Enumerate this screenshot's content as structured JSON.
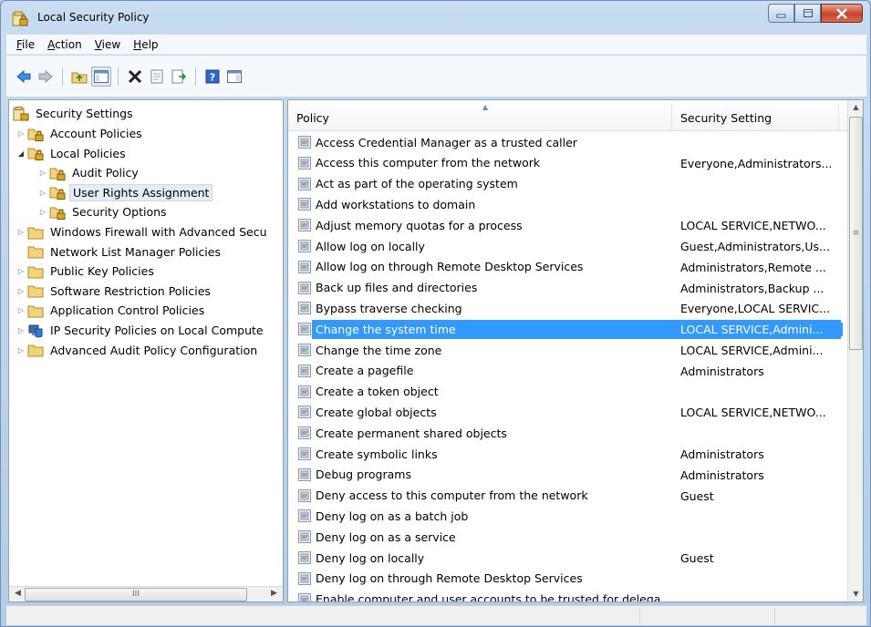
{
  "window": {
    "title": "Local Security Policy"
  },
  "menu": [
    {
      "pre": "",
      "key": "F",
      "post": "ile"
    },
    {
      "pre": "",
      "key": "A",
      "post": "ction"
    },
    {
      "pre": "",
      "key": "V",
      "post": "iew"
    },
    {
      "pre": "",
      "key": "H",
      "post": "elp"
    }
  ],
  "tree": {
    "root": "Security Settings",
    "items": [
      {
        "label": "Account Policies",
        "level": 1,
        "expander": "collapsed",
        "icon": "folder-lock-icon"
      },
      {
        "label": "Local Policies",
        "level": 1,
        "expander": "expanded",
        "icon": "folder-lock-icon"
      },
      {
        "label": "Audit Policy",
        "level": 2,
        "expander": "collapsed",
        "icon": "folder-lock-icon"
      },
      {
        "label": "User Rights Assignment",
        "level": 2,
        "expander": "collapsed",
        "icon": "folder-lock-icon",
        "selected": true
      },
      {
        "label": "Security Options",
        "level": 2,
        "expander": "collapsed",
        "icon": "folder-lock-icon"
      },
      {
        "label": "Windows Firewall with Advanced Secu",
        "level": 1,
        "expander": "collapsed",
        "icon": "folder-icon"
      },
      {
        "label": "Network List Manager Policies",
        "level": 1,
        "expander": "none",
        "icon": "folder-icon"
      },
      {
        "label": "Public Key Policies",
        "level": 1,
        "expander": "collapsed",
        "icon": "folder-icon"
      },
      {
        "label": "Software Restriction Policies",
        "level": 1,
        "expander": "collapsed",
        "icon": "folder-icon"
      },
      {
        "label": "Application Control Policies",
        "level": 1,
        "expander": "collapsed",
        "icon": "folder-icon"
      },
      {
        "label": "IP Security Policies on Local Compute",
        "level": 1,
        "expander": "collapsed",
        "icon": "ipsec-icon"
      },
      {
        "label": "Advanced Audit Policy Configuration",
        "level": 1,
        "expander": "collapsed",
        "icon": "folder-icon"
      }
    ],
    "scroll_thumb_glyph": "III"
  },
  "list": {
    "columns": {
      "policy": "Policy",
      "setting": "Security Setting"
    },
    "rows": [
      {
        "policy": "Access Credential Manager as a trusted caller",
        "setting": ""
      },
      {
        "policy": "Access this computer from the network",
        "setting": "Everyone,Administrators..."
      },
      {
        "policy": "Act as part of the operating system",
        "setting": ""
      },
      {
        "policy": "Add workstations to domain",
        "setting": ""
      },
      {
        "policy": "Adjust memory quotas for a process",
        "setting": "LOCAL SERVICE,NETWO..."
      },
      {
        "policy": "Allow log on locally",
        "setting": "Guest,Administrators,Us..."
      },
      {
        "policy": "Allow log on through Remote Desktop Services",
        "setting": "Administrators,Remote ..."
      },
      {
        "policy": "Back up files and directories",
        "setting": "Administrators,Backup ..."
      },
      {
        "policy": "Bypass traverse checking",
        "setting": "Everyone,LOCAL SERVIC..."
      },
      {
        "policy": "Change the system time",
        "setting": "LOCAL SERVICE,Admini...",
        "selected": true
      },
      {
        "policy": "Change the time zone",
        "setting": "LOCAL SERVICE,Admini..."
      },
      {
        "policy": "Create a pagefile",
        "setting": "Administrators"
      },
      {
        "policy": "Create a token object",
        "setting": ""
      },
      {
        "policy": "Create global objects",
        "setting": "LOCAL SERVICE,NETWO..."
      },
      {
        "policy": "Create permanent shared objects",
        "setting": ""
      },
      {
        "policy": "Create symbolic links",
        "setting": "Administrators"
      },
      {
        "policy": "Debug programs",
        "setting": "Administrators"
      },
      {
        "policy": "Deny access to this computer from the network",
        "setting": "Guest"
      },
      {
        "policy": "Deny log on as a batch job",
        "setting": ""
      },
      {
        "policy": "Deny log on as a service",
        "setting": ""
      },
      {
        "policy": "Deny log on locally",
        "setting": "Guest"
      },
      {
        "policy": "Deny log on through Remote Desktop Services",
        "setting": ""
      },
      {
        "policy": "Enable computer and user accounts to be trusted for delega...",
        "setting": ""
      }
    ]
  },
  "colors": {
    "selection": "#3399ff",
    "close": "#c7442b"
  }
}
